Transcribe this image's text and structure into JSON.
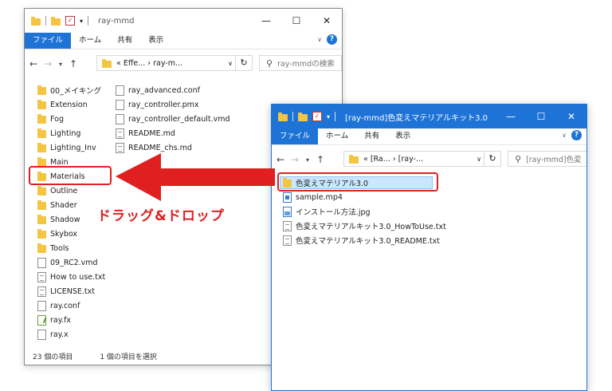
{
  "window1": {
    "title": "ray-mmd",
    "ribbon": {
      "file": "ファイル",
      "home": "ホーム",
      "share": "共有",
      "view": "表示"
    },
    "address": "« Effe... › ray-m...",
    "search_placeholder": "ray-mmdの検索",
    "folders": [
      "00_メイキング",
      "Extension",
      "Fog",
      "Lighting",
      "Lighting_Inv",
      "Main",
      "Materials",
      "Outline",
      "Shader",
      "Shadow",
      "Skybox",
      "Tools"
    ],
    "files_col1": [
      "09_RC2.vmd",
      "How to use.txt",
      "LICENSE.txt",
      "ray.conf",
      "ray.fx",
      "ray.x"
    ],
    "files_col2": [
      "ray_advanced.conf",
      "ray_controller.pmx",
      "ray_controller_default.vmd",
      "README.md",
      "README_chs.md"
    ],
    "status_count": "23 個の項目",
    "status_selected": "1 個の項目を選択"
  },
  "window2": {
    "title": "[ray-mmd]色変えマテリアルキット3.0",
    "ribbon": {
      "file": "ファイル",
      "home": "ホーム",
      "share": "共有",
      "view": "表示"
    },
    "address": "« [Ra... › [ray-...",
    "search_placeholder": "[ray-mmd]色変",
    "items": [
      "色変えマテリアル3.0",
      "sample.mp4",
      "インストール方法.jpg",
      "色変えマテリアルキット3.0_HowToUse.txt",
      "色変えマテリアルキット3.0_README.txt"
    ]
  },
  "annotation": {
    "text": "ドラッグ&ドロップ",
    "color": "#e02020"
  },
  "colors": {
    "accent": "#1e73d6",
    "folder": "#f4c542",
    "highlight": "#e02020"
  },
  "icons": [
    "folder-icon",
    "check-icon",
    "back-arrow-icon",
    "forward-arrow-icon",
    "up-arrow-icon",
    "refresh-icon",
    "search-icon",
    "help-icon",
    "minimize-icon",
    "maximize-icon",
    "close-icon"
  ]
}
